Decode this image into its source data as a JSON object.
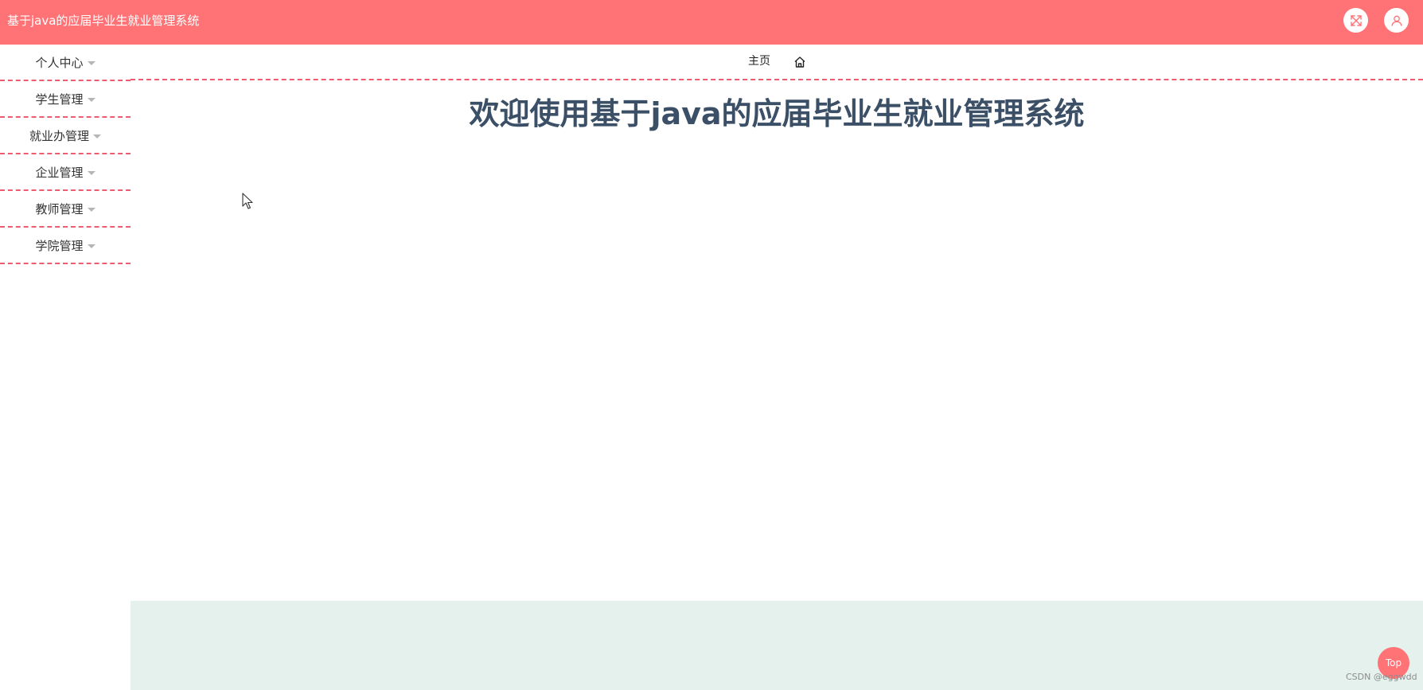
{
  "header": {
    "title": "基于java的应届毕业生就业管理系统",
    "fullscreen_icon": "fullscreen-icon",
    "user_icon": "user-icon",
    "background": "#ff7376"
  },
  "sidebar": {
    "items": [
      {
        "label": "个人中心"
      },
      {
        "label": "学生管理"
      },
      {
        "label": "就业办管理"
      },
      {
        "label": "企业管理"
      },
      {
        "label": "教师管理"
      },
      {
        "label": "学院管理"
      }
    ],
    "divider_color": "#ef5b6f"
  },
  "breadcrumb": {
    "label": "主页",
    "icon": "home-icon"
  },
  "main": {
    "welcome": "欢迎使用基于java的应届毕业生就业管理系统",
    "title_color": "#3b4f66",
    "footer_color": "#e4f1ed"
  },
  "back_to_top": {
    "label": "Top"
  },
  "watermark": "CSDN @eggwdd"
}
